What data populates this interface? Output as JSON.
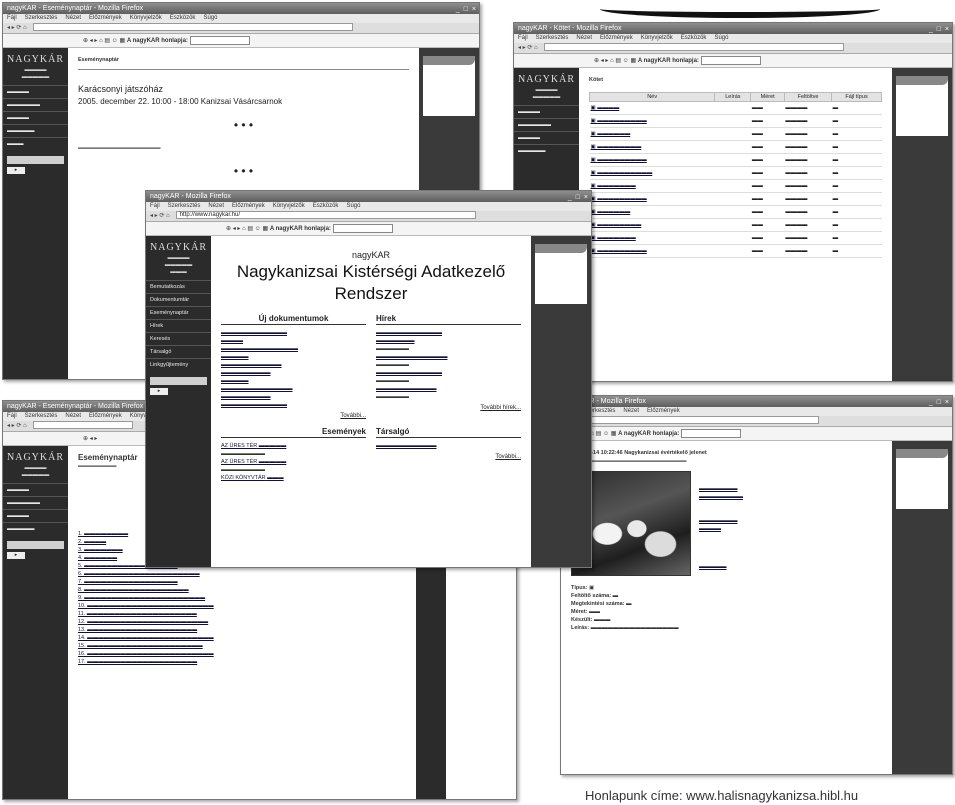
{
  "decor": {
    "swoosh": "brush-stroke"
  },
  "logo": "NAGYKÁR",
  "toolbar_label": "A nagyKAR honlapja:",
  "menu": [
    "Fájl",
    "Szerkesztés",
    "Nézet",
    "Előzmények",
    "Könyvjelzők",
    "Eszközök",
    "Súgó"
  ],
  "win1": {
    "title": "nagyKAR - Eseménynaptár - Mozilla Firefox",
    "heading": "Eseménynaptár",
    "event_title": "Karácsonyi játszóház",
    "event_date": "2005. december 22. 10:00 - 18:00 Kanizsai Vásárcsarnok",
    "dots": "• • •"
  },
  "win2": {
    "title": "nagyKAR - Kötet - Mozilla Firefox",
    "heading": "Kötet",
    "cols": [
      "Név",
      "Leírás",
      "Méret",
      "Feltöltve",
      "Fájl típus"
    ]
  },
  "win3": {
    "title": "nagyKAR - Mozilla Firefox",
    "address": "http://www.nagykar.hu/",
    "subtitle": "nagyKAR",
    "heading_line1": "Nagykanizsai Kistérségi Adatkezelő",
    "heading_line2": "Rendszer",
    "col_new": "Új dokumentumok",
    "col_news": "Hírek",
    "col_events": "Események",
    "col_forum": "Társalgó",
    "more": "További hírek...",
    "more2": "További...",
    "menu_items": [
      "Bemutatkozás",
      "Dokumentumtár",
      "Eseménynaptár",
      "Hírek",
      "Keresés",
      "Társalgó",
      "Linkgyűjtemény"
    ],
    "events": [
      "AZ ÜRES TÉR",
      "AZ ÜRES TÉR",
      "KÖZI KÖNYVTÁR"
    ]
  },
  "win4": {
    "title": "nagyKAR - Eseménynaptár - Mozilla Firefox",
    "heading": "Eseménynaptár"
  },
  "win5": {
    "title": "nagyKAR - Mozilla Firefox",
    "photo_title": "2006-01-14 10:22:46 Nagykanizsai évértékelő jelenet",
    "fields": [
      "Típus:",
      "Feltöltő száma:",
      "Megtekintési száma:",
      "Méret:",
      "Készült:",
      "Leírás:"
    ]
  },
  "caption": "Honlapunk címe: www.halisnagykanizsa.hibl.hu"
}
